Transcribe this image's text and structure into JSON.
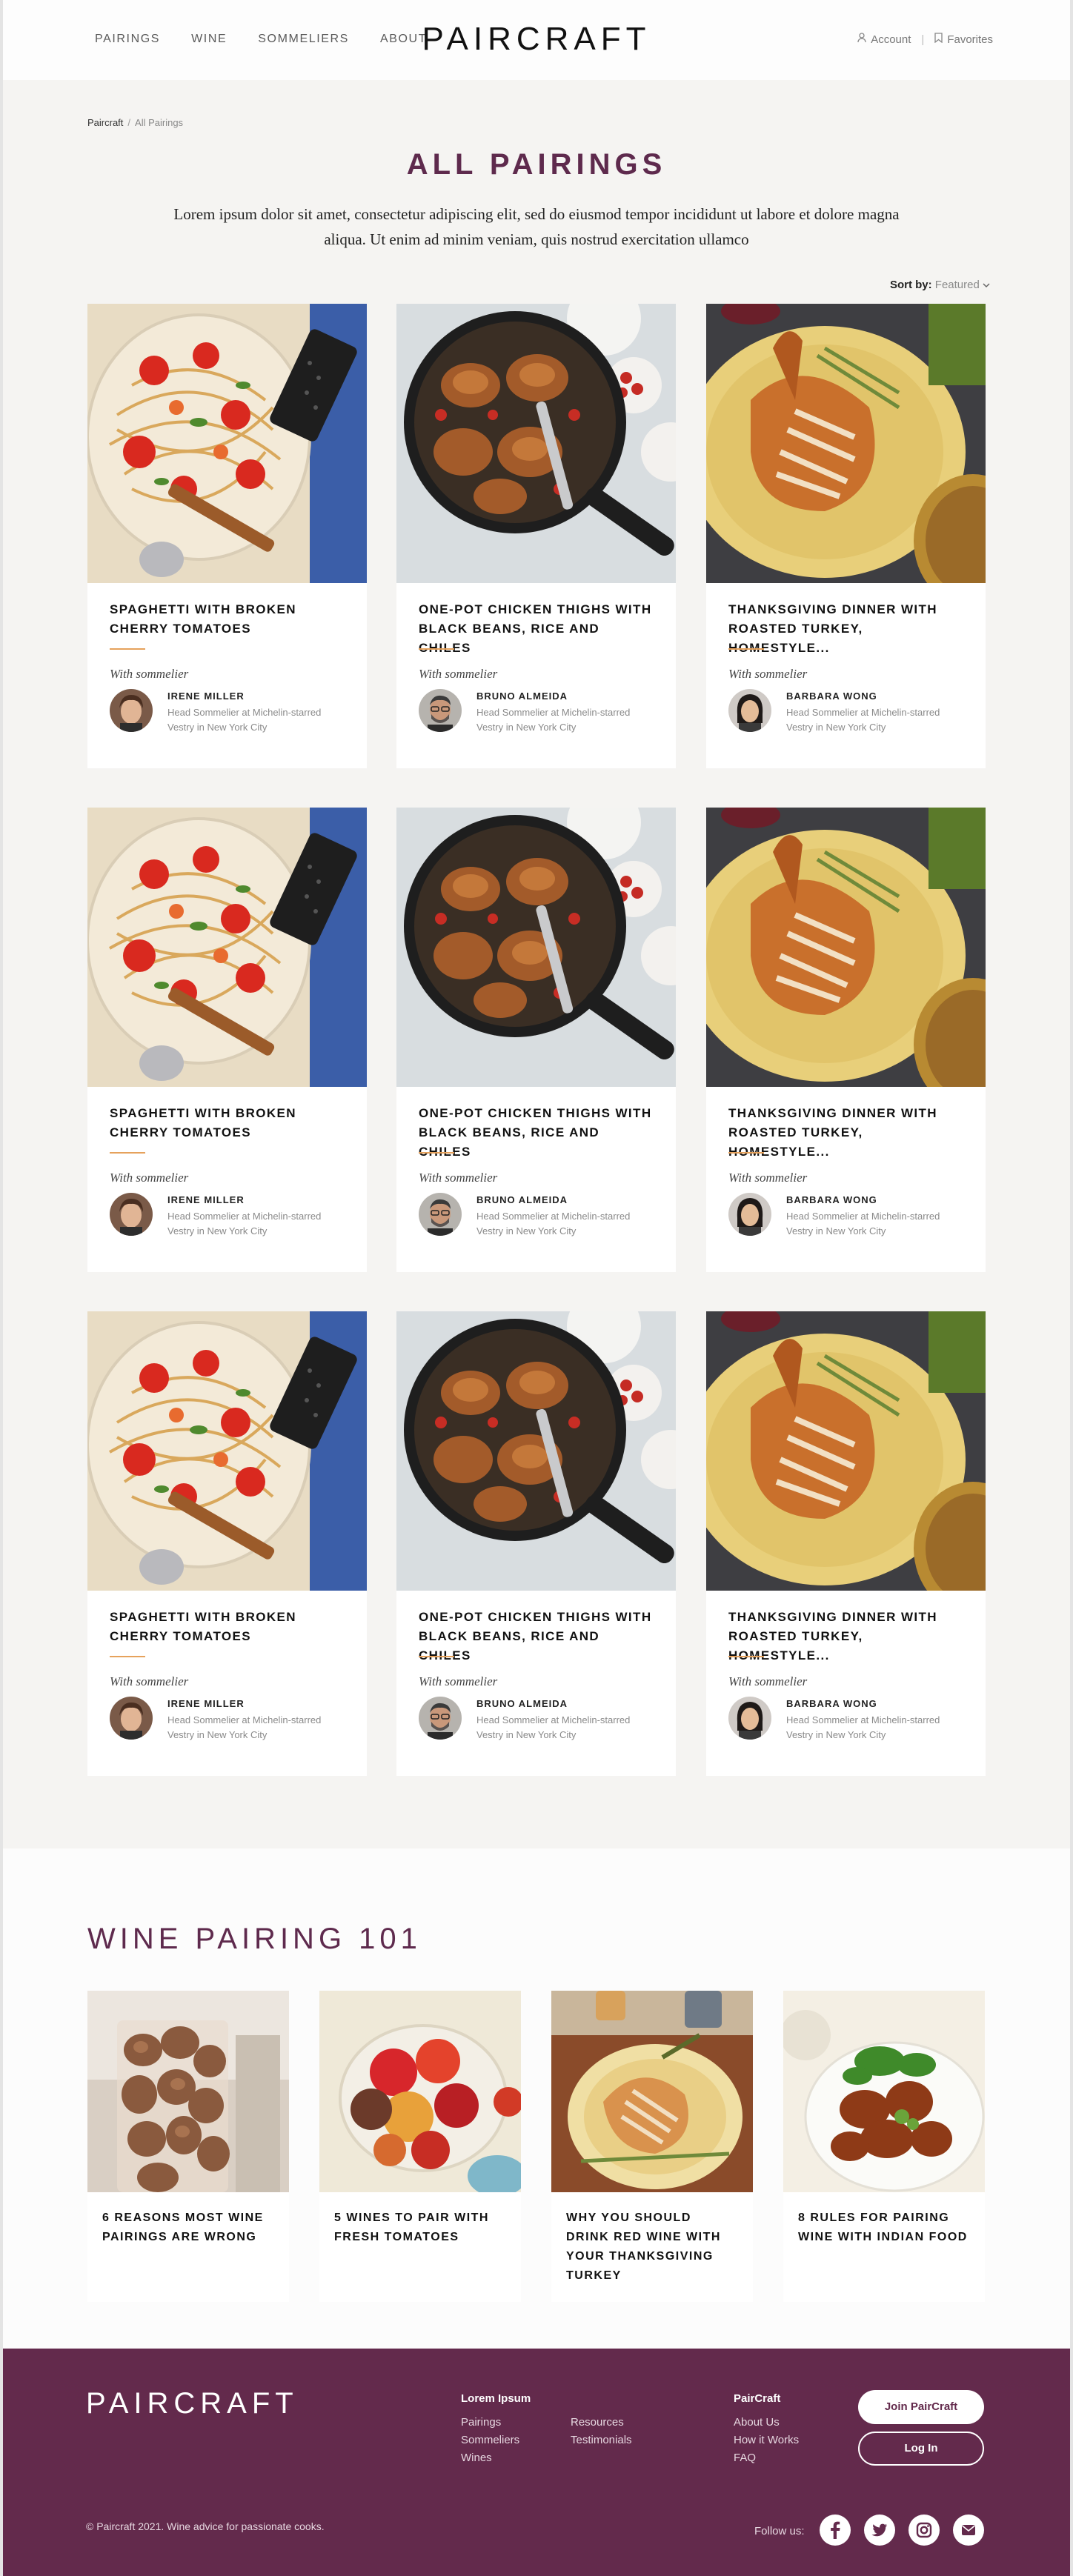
{
  "header": {
    "nav": [
      "PAIRINGS",
      "WINE",
      "SOMMELIERS",
      "ABOUT"
    ],
    "logo": "PAIRCRAFT",
    "account": "Account",
    "favorites": "Favorites"
  },
  "breadcrumb": {
    "home": "Paircraft",
    "sep": "/",
    "current": "All Pairings"
  },
  "main": {
    "title": "ALL PAIRINGS",
    "intro": "Lorem ipsum dolor sit amet, consectetur adipiscing elit, sed do eiusmod tempor incididunt ut labore et dolore magna aliqua. Ut enim ad minim veniam, quis nostrud exercitation ullamco",
    "sort_label": "Sort by:",
    "sort_value": "Featured"
  },
  "cards": [
    {
      "title": "SPAGHETTI WITH BROKEN CHERRY TOMATOES",
      "with": "With sommelier",
      "name": "IRENE MILLER",
      "role": "Head Sommelier at Michelin-starred Vestry in New York City",
      "image": "spaghetti"
    },
    {
      "title": "ONE-POT CHICKEN THIGHS WITH BLACK BEANS, RICE AND CHILES",
      "with": "With sommelier",
      "name": "BRUNO ALMEIDA",
      "role": "Head Sommelier at Michelin-starred Vestry in New York City",
      "image": "chicken"
    },
    {
      "title": "THANKSGIVING DINNER WITH ROASTED TURKEY, HOMESTYLE...",
      "with": "With sommelier",
      "name": "BARBARA WONG",
      "role": "Head Sommelier at Michelin-starred Vestry in New York City",
      "image": "turkey"
    },
    {
      "title": "SPAGHETTI WITH BROKEN CHERRY TOMATOES",
      "with": "With sommelier",
      "name": "IRENE MILLER",
      "role": "Head Sommelier at Michelin-starred Vestry in New York City",
      "image": "spaghetti"
    },
    {
      "title": "ONE-POT CHICKEN THIGHS WITH BLACK BEANS, RICE AND CHILES",
      "with": "With sommelier",
      "name": "BRUNO ALMEIDA",
      "role": "Head Sommelier at Michelin-starred Vestry in New York City",
      "image": "chicken"
    },
    {
      "title": "THANKSGIVING DINNER WITH ROASTED TURKEY, HOMESTYLE...",
      "with": "With sommelier",
      "name": "BARBARA WONG",
      "role": "Head Sommelier at Michelin-starred Vestry in New York City",
      "image": "turkey"
    },
    {
      "title": "SPAGHETTI WITH BROKEN CHERRY TOMATOES",
      "with": "With sommelier",
      "name": "IRENE MILLER",
      "role": "Head Sommelier at Michelin-starred Vestry in New York City",
      "image": "spaghetti"
    },
    {
      "title": "ONE-POT CHICKEN THIGHS WITH BLACK BEANS, RICE AND CHILES",
      "with": "With sommelier",
      "name": "BRUNO ALMEIDA",
      "role": "Head Sommelier at Michelin-starred Vestry in New York City",
      "image": "chicken"
    },
    {
      "title": "THANKSGIVING DINNER WITH ROASTED TURKEY, HOMESTYLE...",
      "with": "With sommelier",
      "name": "BARBARA WONG",
      "role": "Head Sommelier at Michelin-starred Vestry in New York City",
      "image": "turkey"
    }
  ],
  "wine101": {
    "title": "WINE PAIRING 101",
    "articles": [
      {
        "title": "6 REASONS MOST WINE PAIRINGS ARE WRONG",
        "image": "corks"
      },
      {
        "title": "5 WINES TO PAIR WITH FRESH TOMATOES",
        "image": "tomatoes"
      },
      {
        "title": "WHY YOU SHOULD DRINK RED WINE WITH YOUR THANKSGIVING TURKEY",
        "image": "turkey-plate"
      },
      {
        "title": "8 RULES FOR PAIRING WINE WITH INDIAN FOOD",
        "image": "indian-food"
      }
    ]
  },
  "footer": {
    "logo": "PAIRCRAFT",
    "col1_heading": "Lorem Ipsum",
    "col1_links": [
      "Pairings",
      "Sommeliers",
      "Wines"
    ],
    "col2_links": [
      "Resources",
      "Testimonials"
    ],
    "col3_heading": "PairCraft",
    "col3_links": [
      "About Us",
      "How it Works",
      "FAQ"
    ],
    "join": "Join PairCraft",
    "login": "Log In",
    "copyright": "© Paircraft 2021. Wine advice for passionate cooks.",
    "follow": "Follow us:",
    "social": [
      "facebook-icon",
      "twitter-icon",
      "instagram-icon",
      "email-icon"
    ]
  },
  "colors": {
    "brand": "#5e2a4d",
    "footer": "#632a4c",
    "accent": "#e6a25c",
    "background": "#f5f4f2"
  }
}
